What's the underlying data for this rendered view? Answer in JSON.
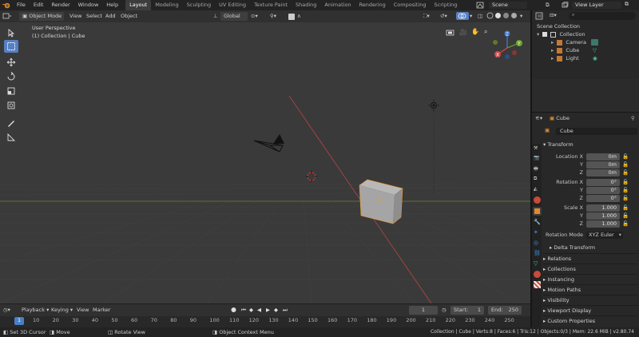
{
  "topbar": {
    "menus": [
      "File",
      "Edit",
      "Render",
      "Window",
      "Help"
    ],
    "workspaces": [
      "Layout",
      "Modeling",
      "Sculpting",
      "UV Editing",
      "Texture Paint",
      "Shading",
      "Animation",
      "Rendering",
      "Compositing",
      "Scripting"
    ],
    "scene_label": "Scene",
    "view_layer_label": "View Layer"
  },
  "viewport_header": {
    "mode": "Object Mode",
    "menus": [
      "View",
      "Select",
      "Add",
      "Object"
    ],
    "transform_orientation": "Global"
  },
  "viewport": {
    "perspective_label": "User Perspective",
    "context_label": "(1) Collection | Cube",
    "gizmo": {
      "x": "X",
      "y": "Y",
      "z": "Z"
    }
  },
  "outliner": {
    "root": "Scene Collection",
    "collection": "Collection",
    "items": [
      "Camera",
      "Cube",
      "Light"
    ]
  },
  "properties": {
    "object_name": "Cube",
    "data_name": "Cube",
    "transform_title": "Transform",
    "location": {
      "label": "Location X",
      "x": "0m",
      "y": "0m",
      "z": "0m"
    },
    "rotation": {
      "label": "Rotation X",
      "x": "0°",
      "y": "0°",
      "z": "0°"
    },
    "scale": {
      "label": "Scale X",
      "x": "1.000",
      "y": "1.000",
      "z": "1.000"
    },
    "axis_y": "Y",
    "axis_z": "Z",
    "rotation_mode_label": "Rotation Mode",
    "rotation_mode_value": "XYZ Euler",
    "delta_transform": "Delta Transform",
    "panels": [
      "Relations",
      "Collections",
      "Instancing",
      "Motion Paths",
      "Visibility",
      "Viewport Display",
      "Custom Properties"
    ]
  },
  "timeline": {
    "menus": [
      "Playback",
      "Keying",
      "View",
      "Marker"
    ],
    "current_frame": "1",
    "start_label": "Start:",
    "start_value": "1",
    "end_label": "End:",
    "end_value": "250",
    "ruler": [
      "1",
      "10",
      "20",
      "30",
      "40",
      "50",
      "60",
      "70",
      "80",
      "90",
      "100",
      "110",
      "120",
      "130",
      "140",
      "150",
      "160",
      "170",
      "180",
      "190",
      "200",
      "210",
      "220",
      "230",
      "240",
      "250"
    ]
  },
  "statusbar": {
    "left": [
      "Set 3D Cursor",
      "Move",
      "Rotate View",
      "Object Context Menu"
    ],
    "right": "Collection | Cube | Verts:8 | Faces:6 | Tris:12 | Objects:0/3 | Mem: 22.6 MiB | v2.80.74"
  },
  "colors": {
    "accent": "#5680c2",
    "active_tab": "#3d3d3d",
    "x_axis": "#d04a4a",
    "y_axis": "#6da52e",
    "z_axis": "#3f7fdc",
    "origin": "#f29a26"
  }
}
